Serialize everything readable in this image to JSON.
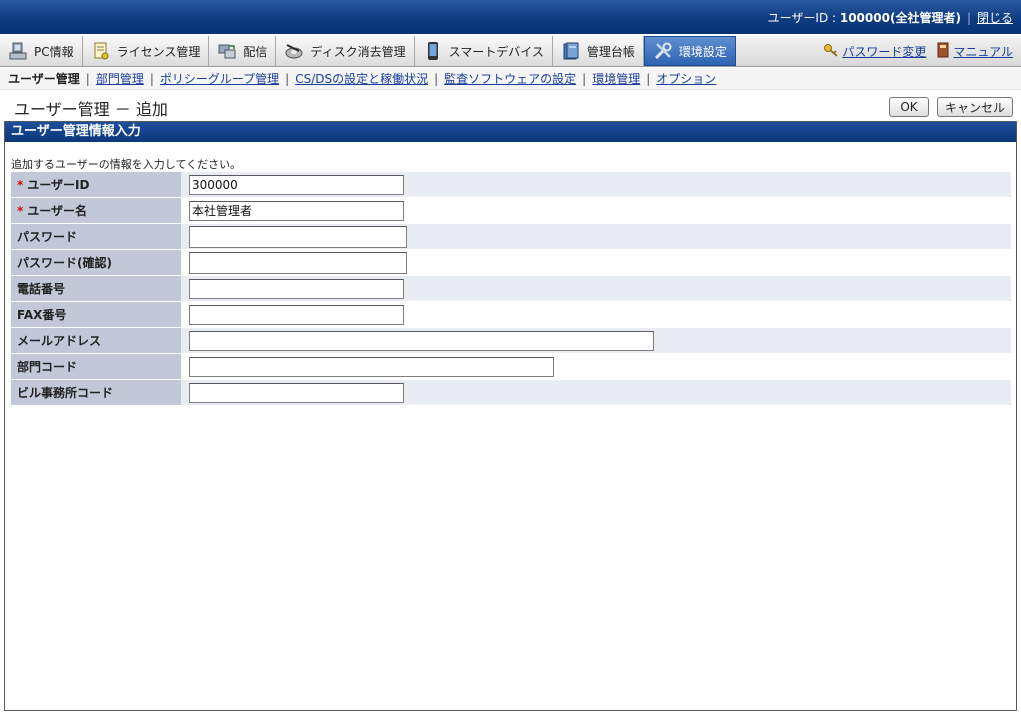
{
  "header": {
    "user_label": "ユーザーID : ",
    "user_value": "100000(全社管理者)",
    "close_link": "閉じる"
  },
  "tabs": [
    {
      "label": "PC情報",
      "icon": "pc-icon"
    },
    {
      "label": "ライセンス管理",
      "icon": "license-icon"
    },
    {
      "label": "配信",
      "icon": "distribution-icon"
    },
    {
      "label": "ディスク消去管理",
      "icon": "disk-erase-icon"
    },
    {
      "label": "スマートデバイス",
      "icon": "smart-device-icon"
    },
    {
      "label": "管理台帳",
      "icon": "ledger-icon"
    },
    {
      "label": "環境設定",
      "icon": "tools-icon"
    }
  ],
  "tab_links": {
    "password_change": "パスワード変更",
    "manual": "マニュアル"
  },
  "subnav": {
    "current": "ユーザー管理",
    "links": [
      "部門管理",
      "ポリシーグループ管理",
      "CS/DSの設定と稼働状況",
      "監査ソフトウェアの設定",
      "環境管理",
      "オプション"
    ]
  },
  "page": {
    "title": "ユーザー管理 － 追加",
    "ok_label": "OK",
    "cancel_label": "キャンセル"
  },
  "panel": {
    "header": "ユーザー管理情報入力",
    "instruction": "追加するユーザーの情報を入力してください。"
  },
  "form": {
    "required_mark": "*",
    "fields": [
      {
        "label": "ユーザーID",
        "value": "300000",
        "required": true
      },
      {
        "label": "ユーザー名",
        "value": "本社管理者",
        "required": true
      },
      {
        "label": "パスワード",
        "value": "",
        "required": false
      },
      {
        "label": "パスワード(確認)",
        "value": "",
        "required": false
      },
      {
        "label": "電話番号",
        "value": "",
        "required": false
      },
      {
        "label": "FAX番号",
        "value": "",
        "required": false
      },
      {
        "label": "メールアドレス",
        "value": "",
        "required": false
      },
      {
        "label": "部門コード",
        "value": "",
        "required": false
      },
      {
        "label": "ビル事務所コード",
        "value": "",
        "required": false
      }
    ]
  },
  "colors": {
    "banner": "#0e3c82",
    "active_tab": "#2d63b2",
    "label_bg": "#c3c8d8",
    "required": "#d01010",
    "link": "#1a3f9a"
  }
}
